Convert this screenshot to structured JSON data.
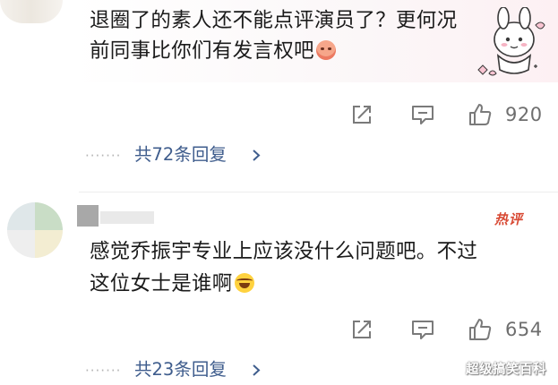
{
  "comments": [
    {
      "text_line1": "退圈了的素人还不能点评演员了？更何况",
      "text_line2": "前同事比你们有发言权吧",
      "emoji": "blush-face-icon",
      "sticker": "cute-bunny-sticker",
      "like_count": "920",
      "reply_dots": "·······",
      "reply_label": "共72条回复"
    },
    {
      "hot_tag": "热评",
      "text_line1": "感觉乔振宇专业上应该没什么问题吧。不过",
      "text_line2": "这位女士是谁啊",
      "emoji": "laughing-tears-icon",
      "like_count": "654",
      "reply_dots": "·······",
      "reply_label": "共23条回复"
    }
  ],
  "action_icons": [
    "share-icon",
    "reply-icon",
    "like-icon"
  ],
  "colors": {
    "reply_link": "#3f5d8d",
    "hot_tag": "#d84a34",
    "muted": "#6e6e6e"
  },
  "watermark": "超级搞笑百科"
}
